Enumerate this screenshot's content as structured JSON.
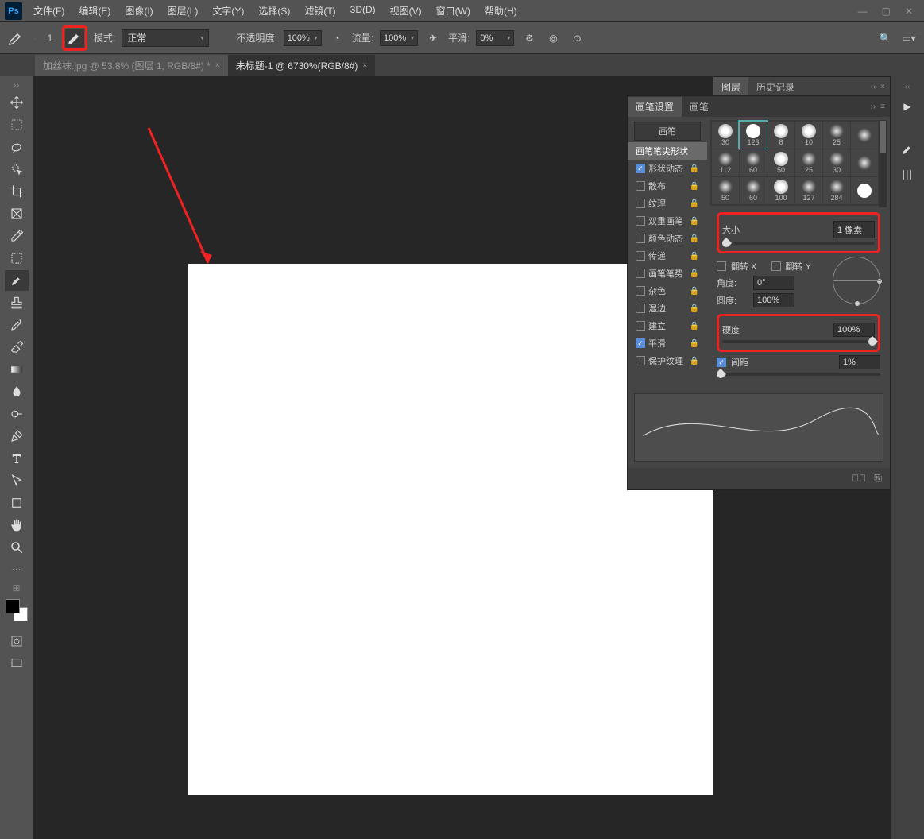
{
  "app": {
    "logo": "Ps"
  },
  "menu": [
    "文件(F)",
    "编辑(E)",
    "图像(I)",
    "图层(L)",
    "文字(Y)",
    "选择(S)",
    "滤镜(T)",
    "3D(D)",
    "视图(V)",
    "窗口(W)",
    "帮助(H)"
  ],
  "optbar": {
    "brush_size": "1",
    "mode_label": "模式:",
    "mode_value": "正常",
    "opacity_label": "不透明度:",
    "opacity_value": "100%",
    "flow_label": "流量:",
    "flow_value": "100%",
    "smooth_label": "平滑:",
    "smooth_value": "0%"
  },
  "tabs": [
    {
      "label": "加丝袜.jpg @ 53.8% (图层 1, RGB/8#) *",
      "active": false
    },
    {
      "label": "未标题-1 @ 6730%(RGB/8#)",
      "active": true
    }
  ],
  "layers_panel": {
    "tabs": [
      "图层",
      "历史记录"
    ]
  },
  "brush_panel": {
    "header_tabs": [
      "画笔设置",
      "画笔"
    ],
    "btn_brush": "画笔",
    "btn_tip": "画笔笔尖形状",
    "options": [
      {
        "label": "形状动态",
        "checked": true,
        "locked": true
      },
      {
        "label": "散布",
        "checked": false,
        "locked": true
      },
      {
        "label": "纹理",
        "checked": false,
        "locked": true
      },
      {
        "label": "双重画笔",
        "checked": false,
        "locked": true
      },
      {
        "label": "颜色动态",
        "checked": false,
        "locked": true
      },
      {
        "label": "传递",
        "checked": false,
        "locked": true
      },
      {
        "label": "画笔笔势",
        "checked": false,
        "locked": true
      },
      {
        "label": "杂色",
        "checked": false,
        "locked": true
      },
      {
        "label": "湿边",
        "checked": false,
        "locked": true
      },
      {
        "label": "建立",
        "checked": false,
        "locked": true
      },
      {
        "label": "平滑",
        "checked": true,
        "locked": true
      },
      {
        "label": "保护纹理",
        "checked": false,
        "locked": true
      }
    ],
    "brush_sizes": [
      "30",
      "123",
      "8",
      "10",
      "25",
      "",
      "112",
      "60",
      "50",
      "25",
      "30",
      "",
      "50",
      "60",
      "100",
      "127",
      "284",
      ""
    ],
    "size_label": "大小",
    "size_value": "1 像素",
    "flipx": "翻转 X",
    "flipy": "翻转 Y",
    "angle_label": "角度:",
    "angle_value": "0°",
    "round_label": "圆度:",
    "round_value": "100%",
    "hard_label": "硬度",
    "hard_value": "100%",
    "spacing_label": "间距",
    "spacing_value": "1%"
  }
}
